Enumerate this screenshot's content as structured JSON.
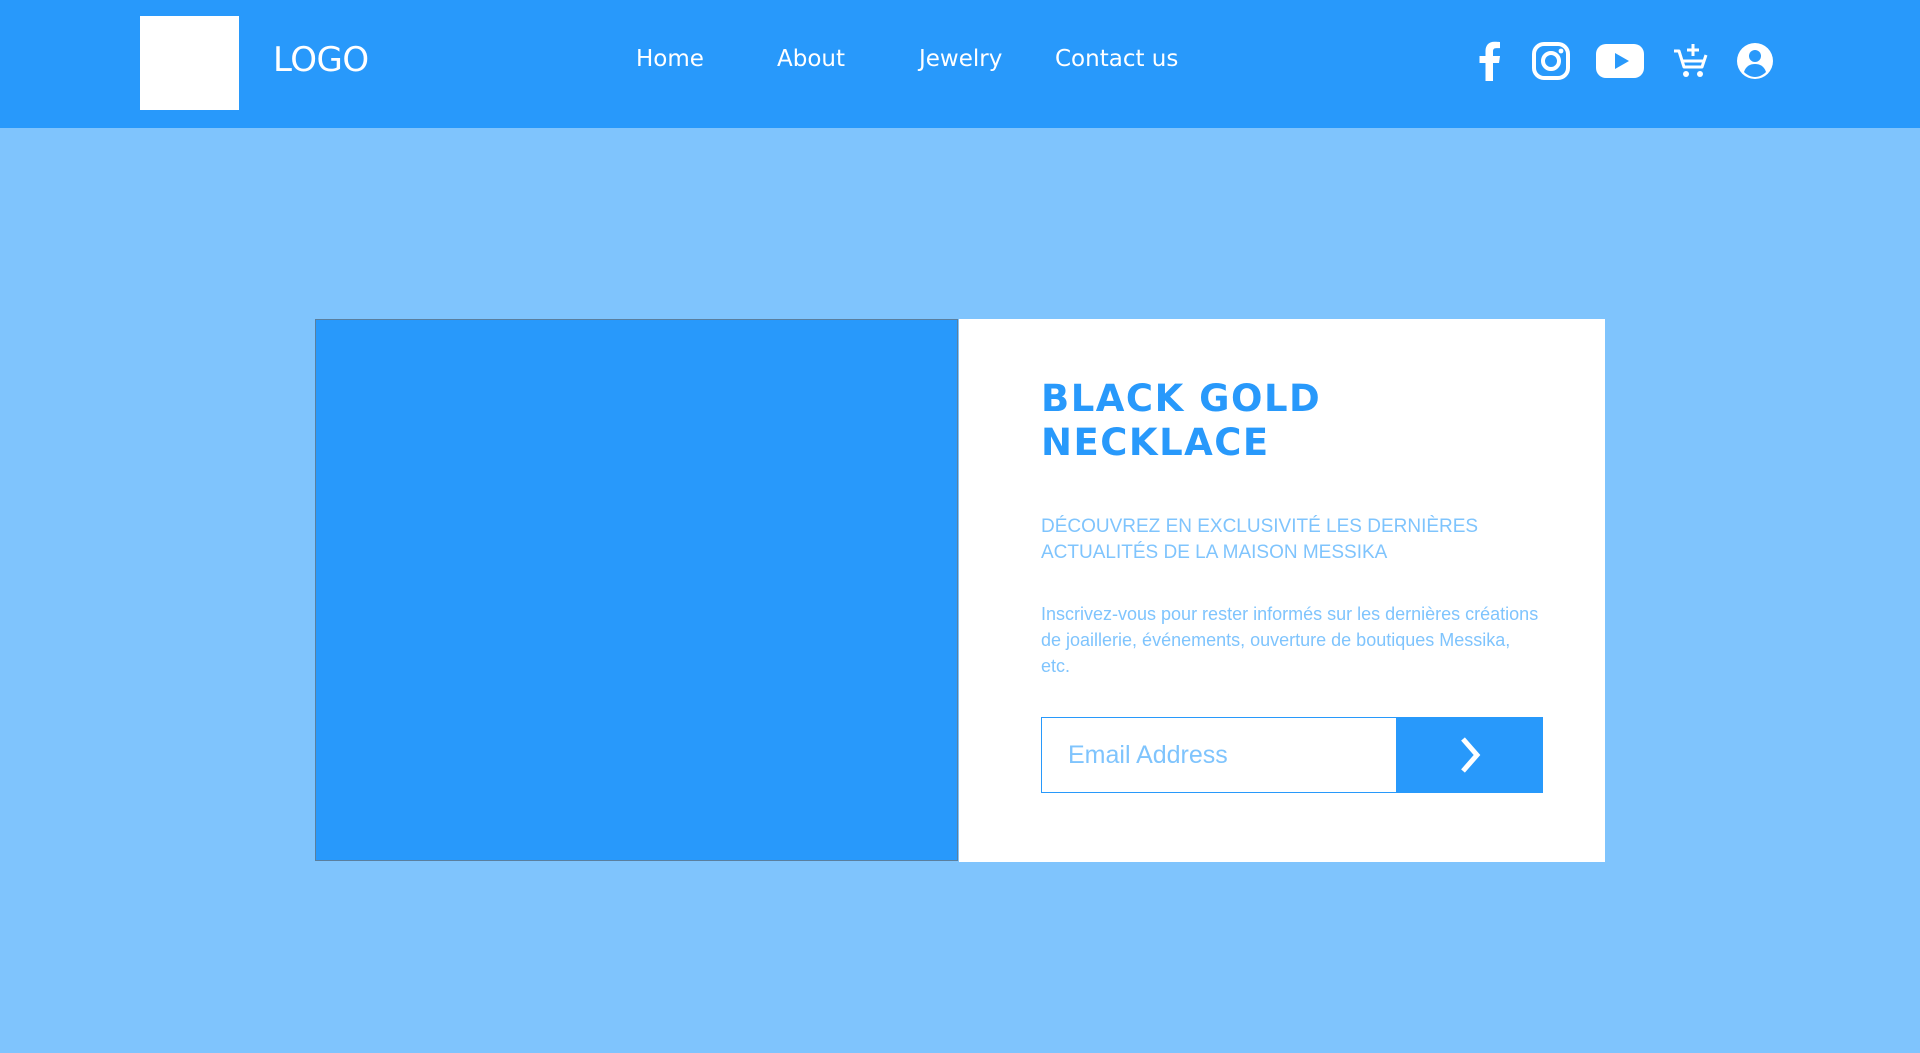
{
  "header": {
    "logo_text": "LOGO",
    "nav": [
      "Home",
      "About",
      "Jewelry",
      "Contact us"
    ],
    "icons": [
      "facebook-icon",
      "instagram-icon",
      "youtube-icon",
      "cart-add-icon",
      "account-icon"
    ]
  },
  "hero": {
    "title_line1": "BLACK GOLD",
    "title_line2": "NECKLACE",
    "subtitle": "DÉCOUVREZ EN EXCLUSIVITÉ LES DERNIÈRES ACTUALITÉS DE LA MAISON MESSIKA",
    "body": "Inscrivez-vous pour rester informés sur les dernières créations de joaillerie, événements, ouverture de boutiques Messika, etc.",
    "email_placeholder": "Email Address",
    "submit_icon": "chevron-right-icon"
  },
  "colors": {
    "header": "#2899fb",
    "background": "#7fc4fd",
    "panel": "#ffffff",
    "accent": "#2899fb"
  }
}
